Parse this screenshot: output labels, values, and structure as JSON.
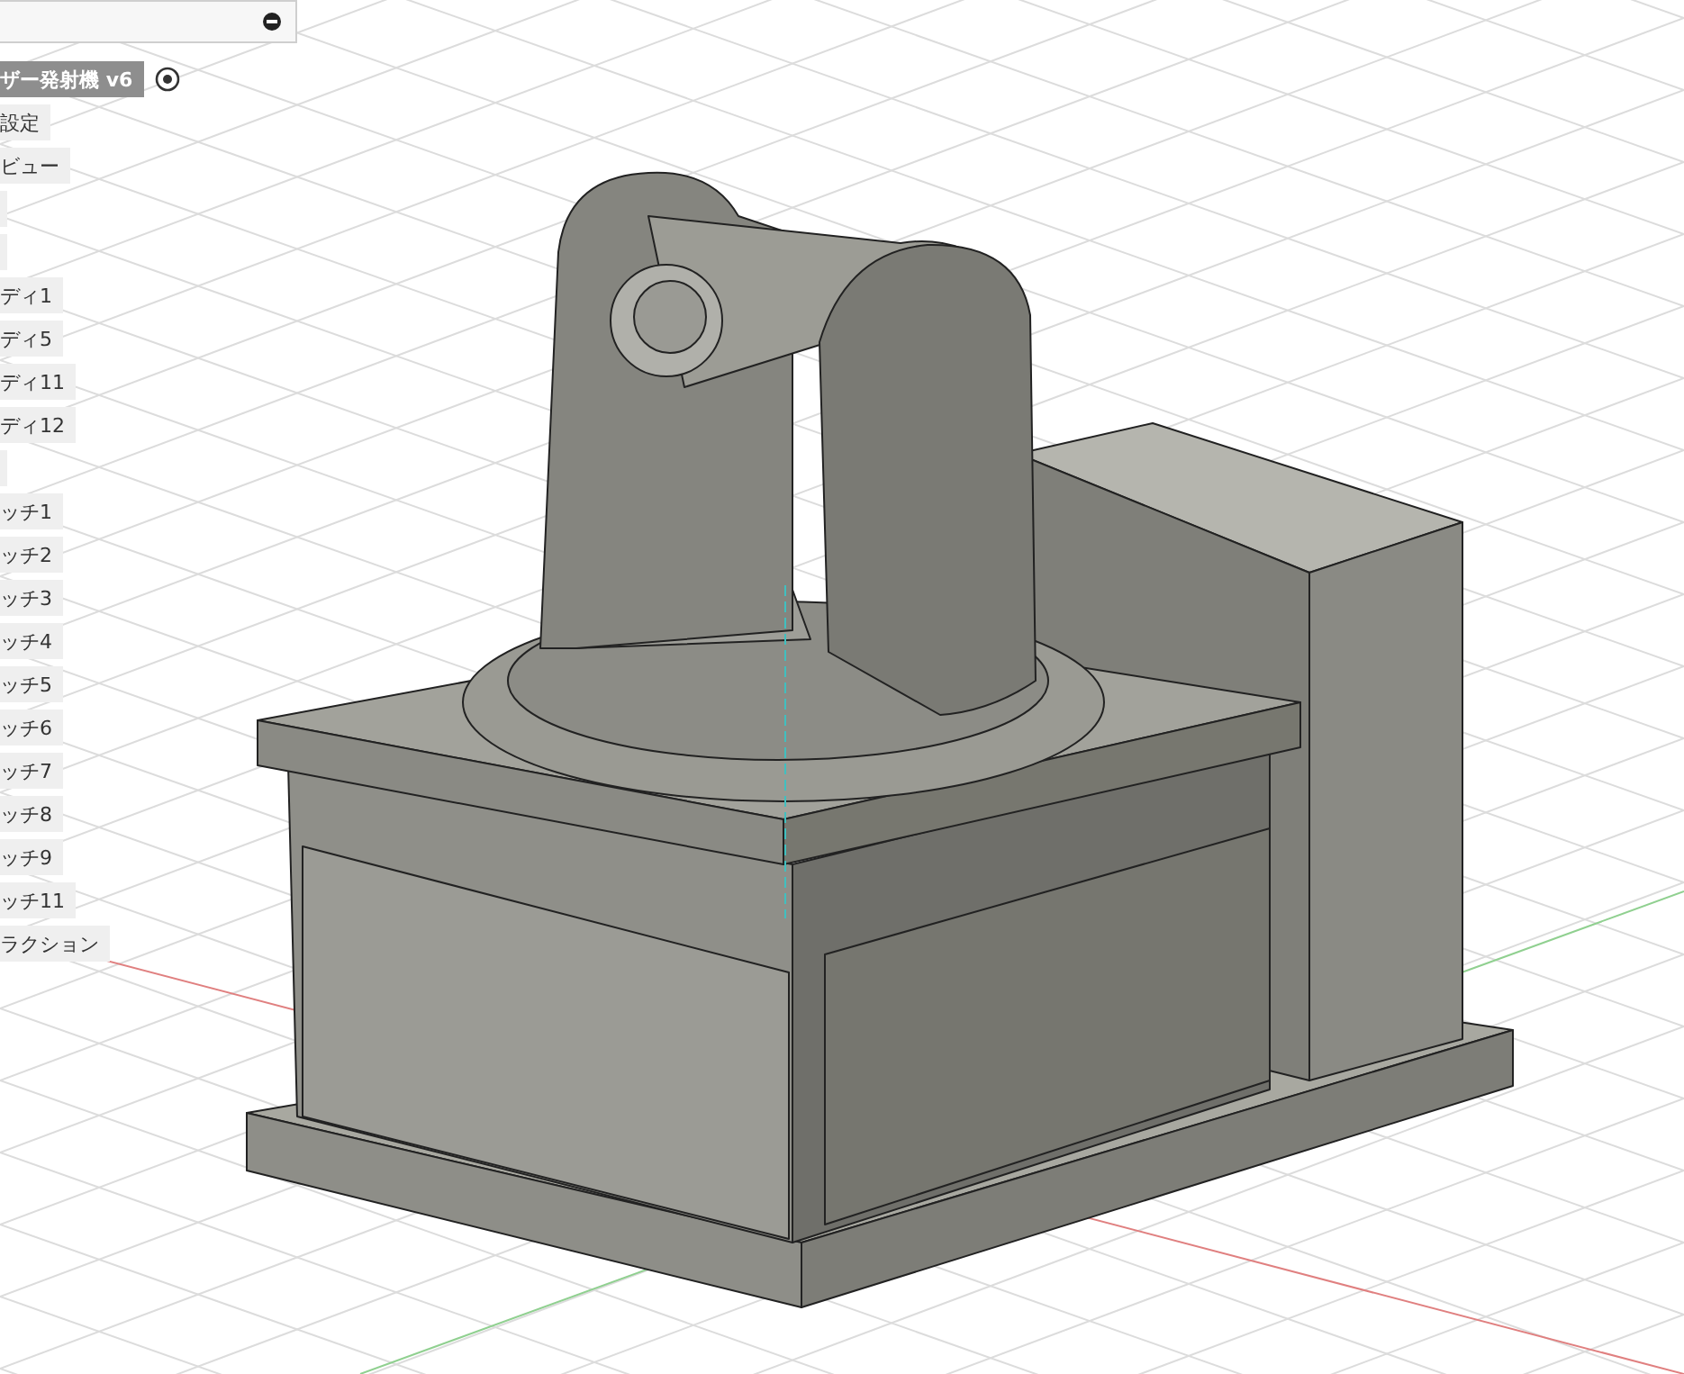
{
  "browser": {
    "items": [
      {
        "kind": "component",
        "label": "ザー発射機 v6",
        "selected": true
      },
      {
        "kind": "node",
        "label": "設定",
        "selected": false
      },
      {
        "kind": "node",
        "label": "ビュー",
        "selected": false
      },
      {
        "kind": "stub",
        "selected": false
      },
      {
        "kind": "stub",
        "selected": false
      },
      {
        "kind": "node",
        "label": "ディ1",
        "selected": false
      },
      {
        "kind": "node",
        "label": "ディ5",
        "selected": false
      },
      {
        "kind": "node",
        "label": "ディ11",
        "selected": false
      },
      {
        "kind": "node",
        "label": "ディ12",
        "selected": false
      },
      {
        "kind": "stub",
        "selected": false
      },
      {
        "kind": "node",
        "label": "ッチ1",
        "selected": false
      },
      {
        "kind": "node",
        "label": "ッチ2",
        "selected": false
      },
      {
        "kind": "node",
        "label": "ッチ3",
        "selected": false
      },
      {
        "kind": "node",
        "label": "ッチ4",
        "selected": false
      },
      {
        "kind": "node",
        "label": "ッチ5",
        "selected": false
      },
      {
        "kind": "node",
        "label": "ッチ6",
        "selected": false
      },
      {
        "kind": "node",
        "label": "ッチ7",
        "selected": false
      },
      {
        "kind": "node",
        "label": "ッチ8",
        "selected": false
      },
      {
        "kind": "node",
        "label": "ッチ9",
        "selected": false
      },
      {
        "kind": "node",
        "label": "ッチ11",
        "selected": false
      },
      {
        "kind": "node",
        "label": "ラクション",
        "selected": false
      }
    ]
  }
}
